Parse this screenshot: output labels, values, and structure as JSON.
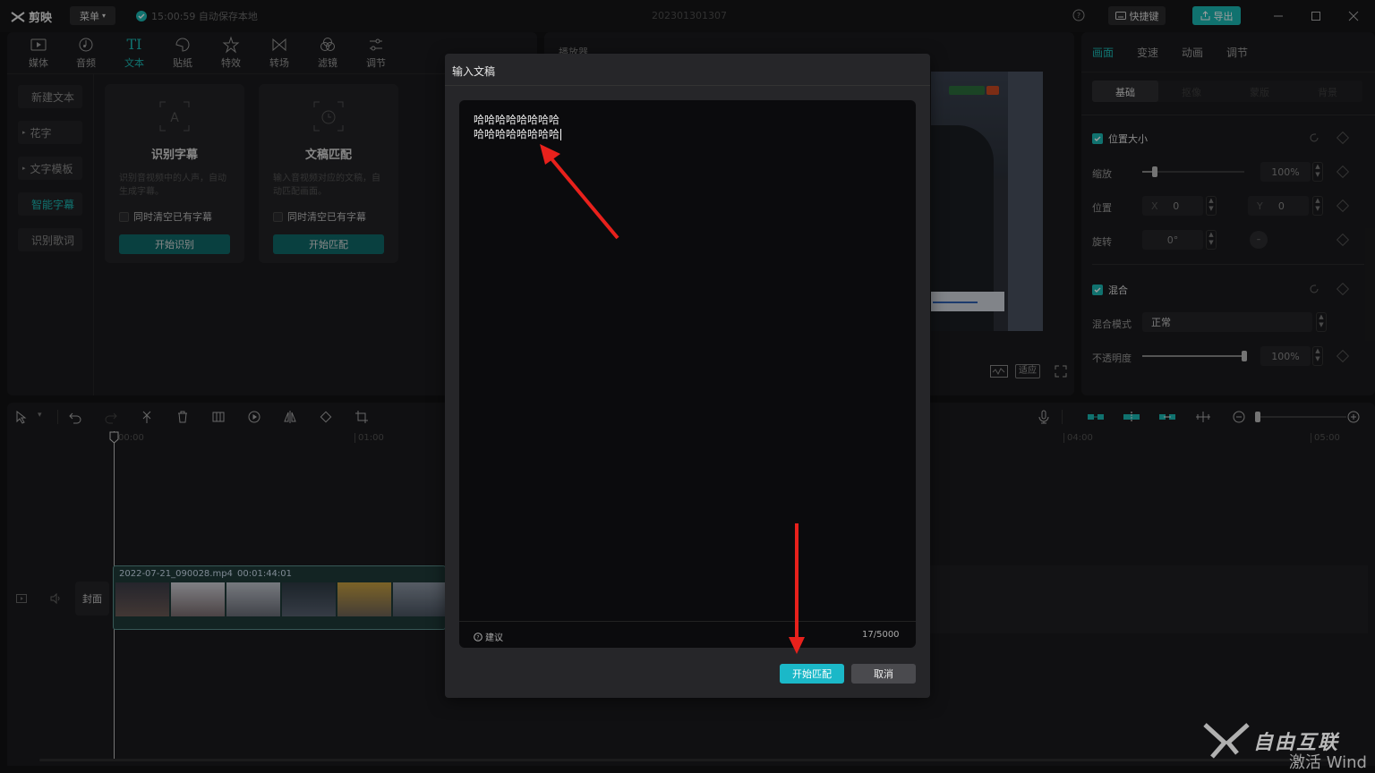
{
  "app": {
    "logo": "剪映",
    "menu_label": "菜单",
    "autosave": "15:00:59 自动保存本地",
    "project_title": "202301301307",
    "shortcut_label": "快捷键",
    "export_label": "导出"
  },
  "media_tabs": [
    "媒体",
    "音频",
    "文本",
    "贴纸",
    "特效",
    "转场",
    "滤镜",
    "调节"
  ],
  "text_sidebar": [
    "新建文本",
    "花字",
    "文字模板",
    "智能字幕",
    "识别歌词"
  ],
  "cards": [
    {
      "title": "识别字幕",
      "desc": "识别音视频中的人声，自动生成字幕。",
      "checkbox": "同时清空已有字幕",
      "button": "开始识别"
    },
    {
      "title": "文稿匹配",
      "desc": "输入音视频对应的文稿，自动匹配画面。",
      "checkbox": "同时清空已有字幕",
      "button": "开始匹配"
    }
  ],
  "player": {
    "title": "播放器",
    "fit_label": "适应"
  },
  "inspector": {
    "tabs": [
      "画面",
      "变速",
      "动画",
      "调节"
    ],
    "subtabs": [
      "基础",
      "抠像",
      "蒙版",
      "背景"
    ],
    "section_position": "位置大小",
    "scale_label": "缩放",
    "scale_value": "100%",
    "scale_level": 0.12,
    "position_label": "位置",
    "pos_x_label": "X",
    "pos_x": "0",
    "pos_y_label": "Y",
    "pos_y": "0",
    "rotate_label": "旋转",
    "rotate_value": "0°",
    "section_blend": "混合",
    "blend_mode_label": "混合模式",
    "blend_mode_value": "正常",
    "opacity_label": "不透明度",
    "opacity_value": "100%",
    "opacity_level": 1.0
  },
  "timeline": {
    "ruler": [
      "00:00",
      "01:00",
      "04:00",
      "05:00"
    ],
    "clip_name": "2022-07-21_090028.mp4",
    "clip_duration": "00:01:44:01",
    "cover_label": "封面"
  },
  "dialog": {
    "title": "输入文稿",
    "lines": [
      "哈哈哈哈哈哈哈哈",
      "哈哈哈哈哈哈哈哈"
    ],
    "suggest_label": "建议",
    "counter": "17/5000",
    "confirm_label": "开始匹配",
    "cancel_label": "取消"
  },
  "watermark": {
    "main": "自由互联",
    "sub": "激活 Wind"
  },
  "colors": {
    "accent": "#1bb8b4",
    "annotation_arrow": "#e8211c"
  }
}
